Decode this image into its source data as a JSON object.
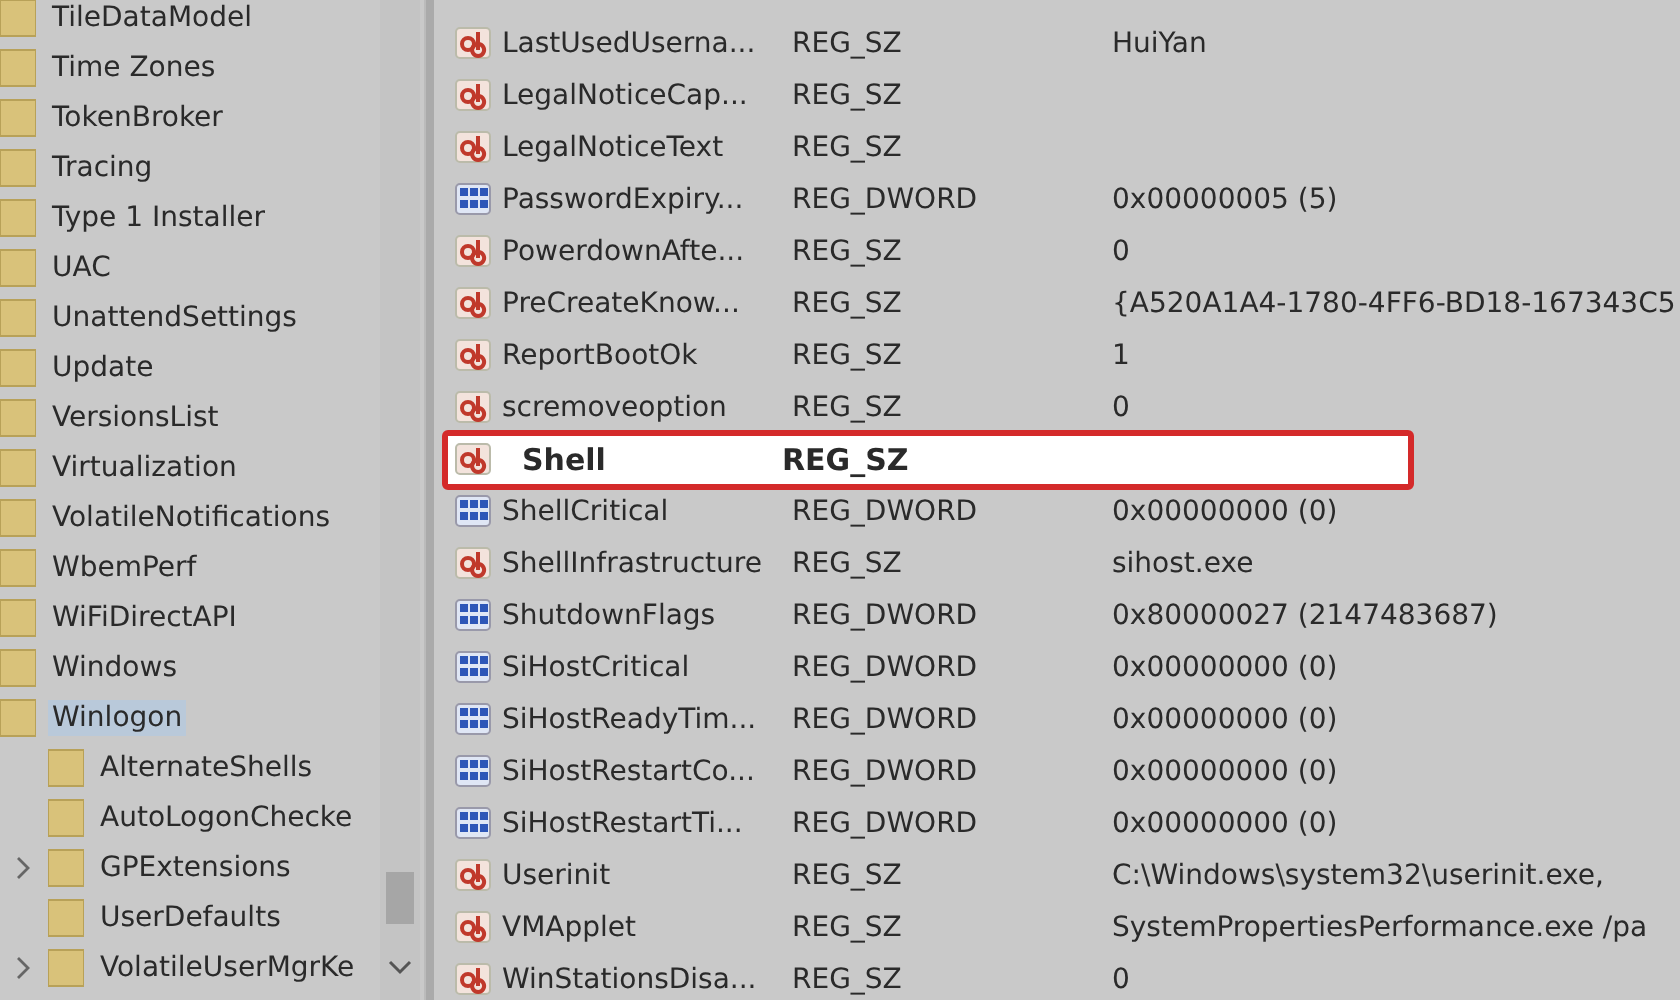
{
  "tree": {
    "items": [
      {
        "label": "TileDataModel",
        "selected": false
      },
      {
        "label": "Time Zones",
        "selected": false
      },
      {
        "label": "TokenBroker",
        "selected": false
      },
      {
        "label": "Tracing",
        "selected": false
      },
      {
        "label": "Type 1 Installer",
        "selected": false
      },
      {
        "label": "UAC",
        "selected": false
      },
      {
        "label": "UnattendSettings",
        "selected": false
      },
      {
        "label": "Update",
        "selected": false
      },
      {
        "label": "VersionsList",
        "selected": false
      },
      {
        "label": "Virtualization",
        "selected": false
      },
      {
        "label": "VolatileNotifications",
        "selected": false
      },
      {
        "label": "WbemPerf",
        "selected": false
      },
      {
        "label": "WiFiDirectAPI",
        "selected": false
      },
      {
        "label": "Windows",
        "selected": false
      },
      {
        "label": "Winlogon",
        "selected": true,
        "children": [
          {
            "label": "AlternateShells",
            "selected": false,
            "expandable": false
          },
          {
            "label": "AutoLogonChecke",
            "selected": false,
            "expandable": false
          },
          {
            "label": "GPExtensions",
            "selected": false,
            "expandable": true
          },
          {
            "label": "UserDefaults",
            "selected": false,
            "expandable": false
          },
          {
            "label": "VolatileUserMgrKe",
            "selected": false,
            "expandable": true
          }
        ]
      }
    ]
  },
  "values": [
    {
      "name": "LastUsedUserna...",
      "type": "REG_SZ",
      "data": "HuiYan",
      "kind": "string",
      "highlighted": false
    },
    {
      "name": "LegalNoticeCap...",
      "type": "REG_SZ",
      "kind": "string",
      "highlighted": false
    },
    {
      "name": "LegalNoticeText",
      "type": "REG_SZ",
      "kind": "string",
      "highlighted": false
    },
    {
      "name": "PasswordExpiry...",
      "type": "REG_DWORD",
      "data": "0x00000005 (5)",
      "kind": "number",
      "highlighted": false
    },
    {
      "name": "PowerdownAfte...",
      "type": "REG_SZ",
      "data": "0",
      "kind": "string",
      "highlighted": false
    },
    {
      "name": "PreCreateKnow...",
      "type": "REG_SZ",
      "data": "{A520A1A4-1780-4FF6-BD18-167343C5",
      "kind": "string",
      "highlighted": false
    },
    {
      "name": "ReportBootOk",
      "type": "REG_SZ",
      "data": "1",
      "kind": "string",
      "highlighted": false
    },
    {
      "name": "scremoveoption",
      "type": "REG_SZ",
      "data": "0",
      "kind": "string",
      "highlighted": false
    },
    {
      "name": "Shell",
      "type": "REG_SZ",
      "kind": "string",
      "highlighted": true
    },
    {
      "name": "ShellCritical",
      "type": "REG_DWORD",
      "data": "0x00000000 (0)",
      "kind": "number",
      "highlighted": false
    },
    {
      "name": "ShellInfrastructure",
      "type": "REG_SZ",
      "data": "sihost.exe",
      "kind": "string",
      "highlighted": false
    },
    {
      "name": "ShutdownFlags",
      "type": "REG_DWORD",
      "data": "0x80000027 (2147483687)",
      "kind": "number",
      "highlighted": false
    },
    {
      "name": "SiHostCritical",
      "type": "REG_DWORD",
      "data": "0x00000000 (0)",
      "kind": "number",
      "highlighted": false
    },
    {
      "name": "SiHostReadyTim...",
      "type": "REG_DWORD",
      "data": "0x00000000 (0)",
      "kind": "number",
      "highlighted": false
    },
    {
      "name": "SiHostRestartCo...",
      "type": "REG_DWORD",
      "data": "0x00000000 (0)",
      "kind": "number",
      "highlighted": false
    },
    {
      "name": "SiHostRestartTi...",
      "type": "REG_DWORD",
      "data": "0x00000000 (0)",
      "kind": "number",
      "highlighted": false
    },
    {
      "name": "Userinit",
      "type": "REG_SZ",
      "data": "C:\\Windows\\system32\\userinit.exe,",
      "kind": "string",
      "highlighted": false
    },
    {
      "name": "VMApplet",
      "type": "REG_SZ",
      "data": "SystemPropertiesPerformance.exe /pa",
      "kind": "string",
      "highlighted": false
    },
    {
      "name": "WinStationsDisa...",
      "type": "REG_SZ",
      "data": "0",
      "kind": "string",
      "highlighted": false
    }
  ]
}
